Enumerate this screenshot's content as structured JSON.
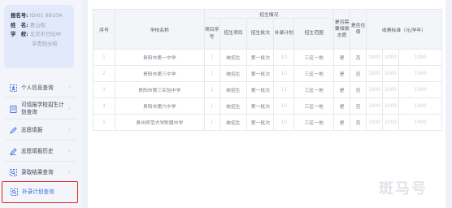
{
  "profile": {
    "reg_label": "报名号:",
    "reg_value": "IDI01 9B10A",
    "name_label": "姓　名:",
    "name_value": "贾山权",
    "school_label": "学　校:",
    "school_value_line1": "北京市日坛中",
    "school_value_line2": "学贵阳分校"
  },
  "sidebar": {
    "items": [
      {
        "label": "个人信息查询",
        "icon": "user-card-icon"
      },
      {
        "label": "可填报学校招生计划查询",
        "icon": "document-icon"
      },
      {
        "label": "志愿填报",
        "icon": "edit-icon"
      },
      {
        "label": "志愿填报历史",
        "icon": "history-edit-icon"
      },
      {
        "label": "录取结果查询",
        "icon": "search-result-icon"
      },
      {
        "label": "补录计划查询",
        "icon": "plan-search-icon"
      }
    ]
  },
  "table": {
    "headers": {
      "seq": "序号",
      "school_name": "学校名称",
      "enroll_group": "招生情况",
      "project_seq": "项目序号",
      "enroll_project": "招生项目",
      "enroll_batch": "招生批次",
      "supp_plan": "补录计划",
      "enroll_range": "招生范围",
      "need_fill": "是否需要填报志愿",
      "boarding": "是否住宿",
      "fee": "收费标准（元/学年）"
    },
    "rows": [
      {
        "seq": "1",
        "school": "贵阳市第一中学",
        "project_seq": "1",
        "project": "统招生",
        "batch": "第一批次",
        "plan": "10",
        "range": "三区一地",
        "fill": "是",
        "board": "否",
        "fees": [
          "1000",
          "1000",
          "1000",
          "1000"
        ]
      },
      {
        "seq": "2",
        "school": "贵阳市第三中学",
        "project_seq": "1",
        "project": "统招生",
        "batch": "第一批次",
        "plan": "10",
        "range": "三区一地",
        "fill": "是",
        "board": "否",
        "fees": [
          "1000",
          "1000",
          "1000",
          "1000"
        ]
      },
      {
        "seq": "3",
        "school": "贵阳市第三实验中学",
        "project_seq": "1",
        "project": "统招生",
        "batch": "第一批次",
        "plan": "11",
        "range": "三区一地",
        "fill": "是",
        "board": "否",
        "fees": [
          "1000",
          "1000",
          "1000",
          "1000"
        ]
      },
      {
        "seq": "4",
        "school": "贵阳市第六中学",
        "project_seq": "1",
        "project": "统招生",
        "batch": "第一批次",
        "plan": "10",
        "range": "三区一地",
        "fill": "是",
        "board": "否",
        "fees": [
          "1000",
          "1000",
          "1000",
          "1000"
        ]
      },
      {
        "seq": "5",
        "school": "贵州师范大学附属中学",
        "project_seq": "1",
        "project": "统招生",
        "batch": "第一批次",
        "plan": "10",
        "range": "三区一地",
        "fill": "是",
        "board": "否",
        "fees": [
          "1000",
          "1000",
          "1000",
          "1000"
        ]
      }
    ]
  },
  "watermark": "斑马号"
}
